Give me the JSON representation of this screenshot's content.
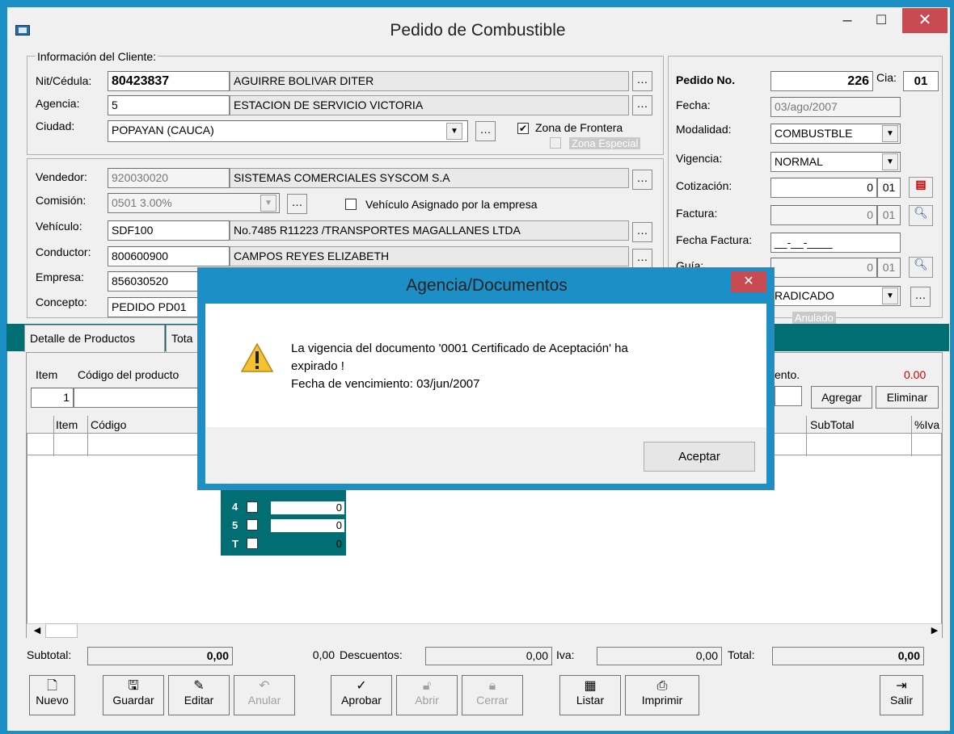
{
  "window": {
    "title": "Pedido de Combustible",
    "minimize": "–",
    "maximize": "☐",
    "close": "✕"
  },
  "client_info": {
    "group_label": "Información del Cliente:",
    "nit_label": "Nit/Cédula:",
    "nit": "80423837",
    "nit_name": "AGUIRRE BOLIVAR DITER",
    "agencia_label": "Agencia:",
    "agencia": "5",
    "agencia_name": "ESTACION DE SERVICIO VICTORIA",
    "ciudad_label": "Ciudad:",
    "ciudad": "POPAYAN  (CAUCA)",
    "zona_frontera": "Zona de Frontera",
    "zona_especial": "Zona Especial"
  },
  "sales": {
    "vendedor_label": "Vendedor:",
    "vendedor": "920030020",
    "vendedor_name": "SISTEMAS COMERCIALES SYSCOM S.A",
    "comision_label": "Comisión:",
    "comision": "0501  3.00%",
    "vehiculo_asignado": "Vehículo Asignado por la empresa",
    "vehiculo_label": "Vehículo:",
    "vehiculo": "SDF100",
    "vehiculo_desc": "No.7485  R11223 /TRANSPORTES MAGALLANES LTDA",
    "conductor_label": "Conductor:",
    "conductor": "800600900",
    "conductor_name": "CAMPOS REYES ELIZABETH",
    "empresa_label": "Empresa:",
    "empresa": "856030520",
    "concepto_label": "Concepto:",
    "concepto": "PEDIDO PD01"
  },
  "order": {
    "pedido_label": "Pedido No.",
    "pedido": "226",
    "cia_label": "Cia:",
    "cia": "01",
    "fecha_label": "Fecha:",
    "fecha": "03/ago/2007",
    "modalidad_label": "Modalidad:",
    "modalidad": "COMBUSTBLE",
    "vigencia_label": "Vigencia:",
    "vigencia": "NORMAL",
    "cotizacion_label": "Cotización:",
    "cotizacion": "0",
    "cotizacion_cia": "01",
    "factura_label": "Factura:",
    "factura": "0",
    "factura_cia": "01",
    "fecha_factura_label": "Fecha Factura:",
    "fecha_factura": "__-__-____",
    "guia_label": "Guía:",
    "guia": "0",
    "guia_cia": "01",
    "estado": "RADICADO",
    "anulado": "Anulado"
  },
  "tabs": [
    "Detalle de Productos",
    "Tota"
  ],
  "detail": {
    "item_label": "Item",
    "codigo_label": "Código del producto",
    "item_value": "1",
    "descuento_label": "ento.",
    "descuento_value": "0.00",
    "agregar": "Agregar",
    "eliminar": "Eliminar",
    "grid_cols": [
      "Item",
      "Código",
      "SubTotal",
      "%Iva"
    ]
  },
  "mini_grid": [
    {
      "label": "4",
      "value": "0"
    },
    {
      "label": "5",
      "value": "0"
    },
    {
      "label": "T",
      "value": "0"
    }
  ],
  "totals": {
    "subtotal_label": "Subtotal:",
    "subtotal": "0,00",
    "subtotal2": "0,00",
    "descuentos_label": "Descuentos:",
    "descuentos": "0,00",
    "iva_label": "Iva:",
    "iva": "0,00",
    "total_label": "Total:",
    "total": "0,00"
  },
  "toolbar": [
    {
      "label": "Nuevo",
      "icon": "new-doc-icon",
      "enabled": true
    },
    {
      "label": "Guardar",
      "icon": "save-icon",
      "enabled": true
    },
    {
      "label": "Editar",
      "icon": "edit-icon",
      "enabled": true
    },
    {
      "label": "Anular",
      "icon": "undo-icon",
      "enabled": false
    },
    {
      "label": "Aprobar",
      "icon": "approve-icon",
      "enabled": true
    },
    {
      "label": "Abrir",
      "icon": "unlock-icon",
      "enabled": false
    },
    {
      "label": "Cerrar",
      "icon": "lock-icon",
      "enabled": false
    },
    {
      "label": "Listar",
      "icon": "calendar-icon",
      "enabled": true
    },
    {
      "label": "Imprimir",
      "icon": "printer-icon",
      "enabled": true
    },
    {
      "label": "Salir",
      "icon": "exit-icon",
      "enabled": true
    }
  ],
  "dialog": {
    "title": "Agencia/Documentos",
    "close": "✕",
    "message_line1": "La vigencia del documento '0001 Certificado de Aceptación' ha",
    "message_line2": "expirado !",
    "message_line3": "Fecha de vencimiento: 03/jun/2007",
    "ok": "Aceptar"
  }
}
